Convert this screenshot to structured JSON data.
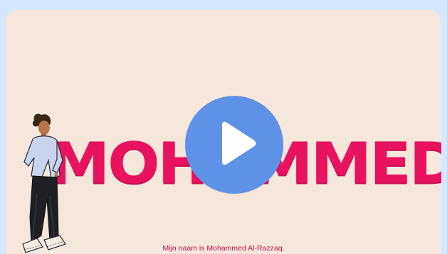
{
  "video": {
    "title_text": "MOHAMMED",
    "caption": "Mijn naam is Mohammed Al-Razzaq."
  },
  "play_button": {
    "icon": "play-icon"
  },
  "colors": {
    "page_background": "#d6e6fb",
    "card_background": "#f5e7db",
    "title_color": "#e8125f",
    "play_button": "#5d92e6"
  }
}
